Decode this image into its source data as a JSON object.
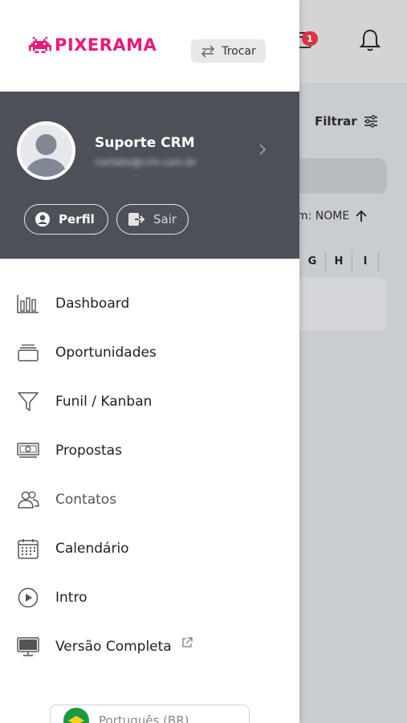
{
  "background": {
    "badge_count": "1",
    "filter_label": "Filtrar",
    "sort_label": "m: NOME",
    "letters": [
      "G",
      "H",
      "I"
    ]
  },
  "drawer": {
    "logo_text": "PIXERAMA",
    "switch_label": "Trocar",
    "user": {
      "name": "Suporte CRM",
      "email": "contato@crm.com.br"
    },
    "profile_button": "Perfil",
    "logout_button": "Sair",
    "menu": [
      {
        "label": "Dashboard",
        "icon": "bar-chart-icon"
      },
      {
        "label": "Oportunidades",
        "icon": "stack-icon"
      },
      {
        "label": "Funil / Kanban",
        "icon": "funnel-icon"
      },
      {
        "label": "Propostas",
        "icon": "money-icon"
      },
      {
        "label": "Contatos",
        "icon": "people-icon"
      },
      {
        "label": "Calendário",
        "icon": "calendar-icon"
      },
      {
        "label": "Intro",
        "icon": "play-circle-icon"
      },
      {
        "label": "Versão Completa",
        "icon": "monitor-icon"
      }
    ],
    "language": "Português (BR)"
  },
  "colors": {
    "brand": "#e8197c",
    "user_panel": "#4d5058",
    "badge": "#d9343f"
  }
}
